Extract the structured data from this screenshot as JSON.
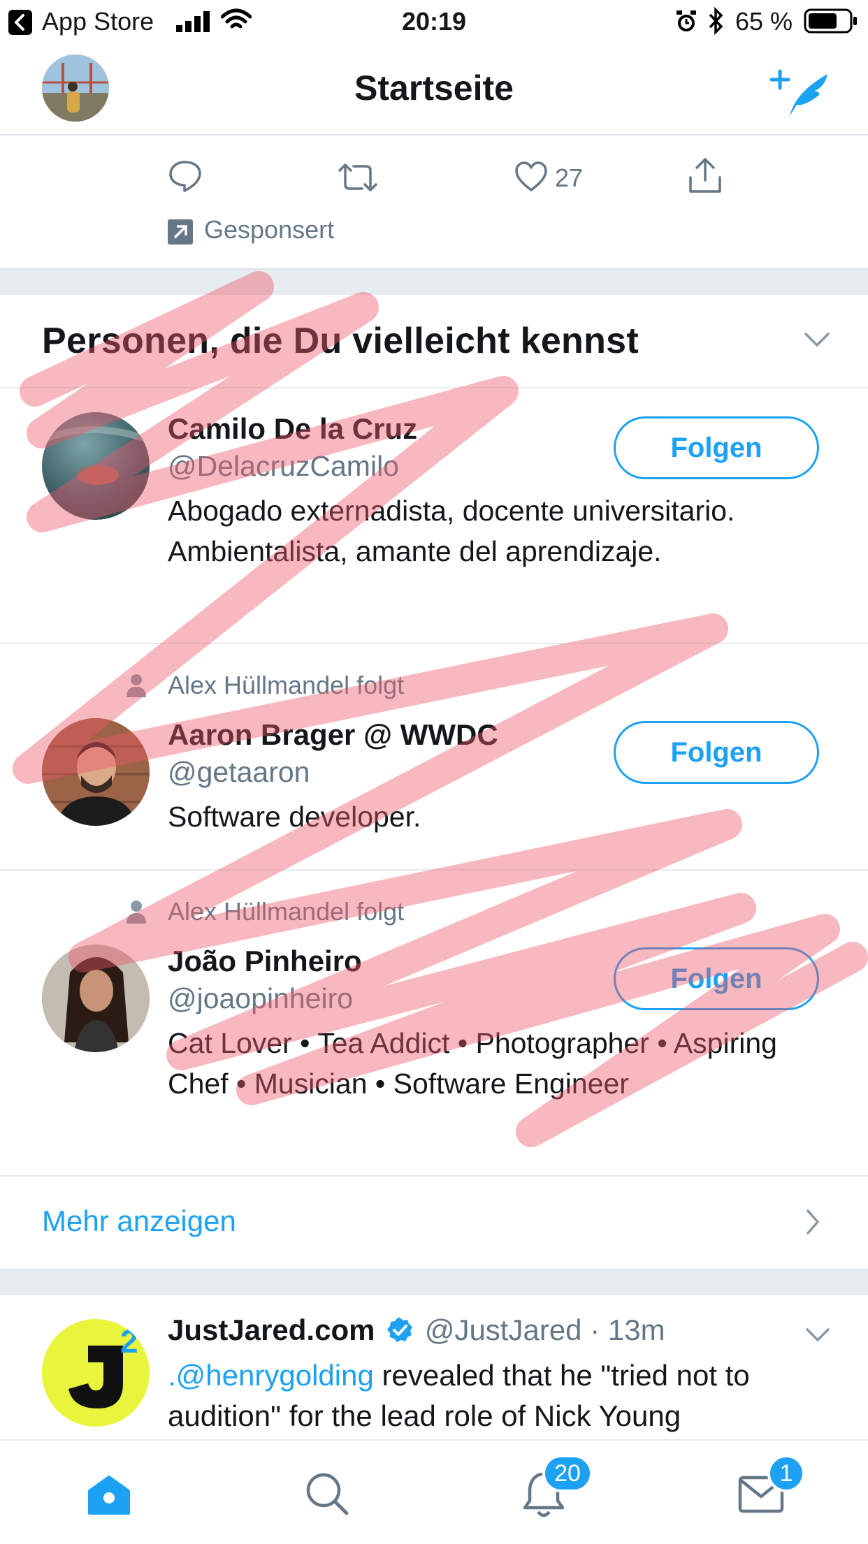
{
  "status_bar": {
    "back_app": "App Store",
    "time": "20:19",
    "battery": "65 %"
  },
  "nav": {
    "title": "Startseite"
  },
  "tweet_actions": {
    "like_count": "27",
    "sponsored_label": "Gesponsert"
  },
  "suggestions": {
    "title": "Personen, die Du vielleicht kennst",
    "people": [
      {
        "context": "",
        "name": "Camilo De la Cruz",
        "handle": "@DelacruzCamilo",
        "bio": "Abogado externadista, docente universitario. Ambientalista, amante del aprendizaje.",
        "follow_label": "Folgen"
      },
      {
        "context": "Alex Hüllmandel folgt",
        "name": "Aaron Brager @ WWDC",
        "handle": "@getaaron",
        "bio": "Software developer.",
        "follow_label": "Folgen"
      },
      {
        "context": "Alex Hüllmandel folgt",
        "name": "João Pinheiro",
        "handle": "@joaopinheiro",
        "bio": "Cat Lover • Tea Addict • Photographer • Aspiring Chef • Musician • Software Engineer",
        "follow_label": "Folgen"
      }
    ],
    "show_more": "Mehr anzeigen"
  },
  "tweet": {
    "author": "JustJared.com",
    "handle": "@JustJared",
    "separator": "·",
    "time": "13m",
    "mention": ".@henrygolding",
    "text_rest": " revealed that he \"tried not to audition\" for the lead role of Nick Young"
  },
  "tabbar": {
    "notifications_badge": "20",
    "messages_badge": "1"
  },
  "colors": {
    "accent": "#1da1f2",
    "muted": "#657786",
    "divider": "#e6ecf0",
    "scribble": "#ee5566"
  }
}
